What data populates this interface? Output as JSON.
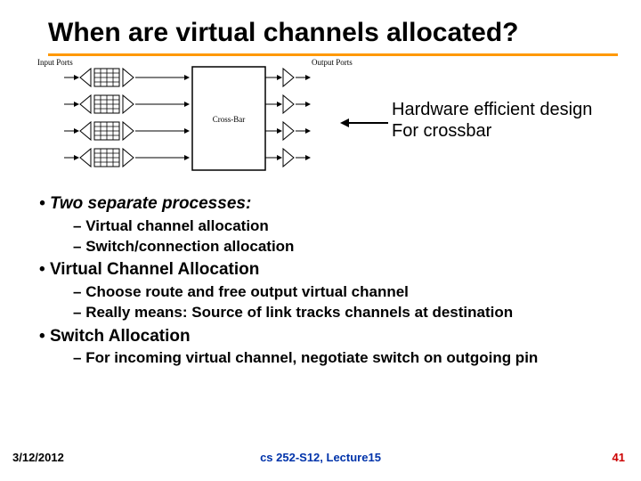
{
  "title": "When are virtual channels allocated?",
  "diagram": {
    "input_label": "Input Ports",
    "output_label": "Output Ports",
    "crossbar_label": "Cross-Bar"
  },
  "annotation": {
    "line1": "Hardware efficient design",
    "line2": "For crossbar"
  },
  "bullets": {
    "b1": "Two separate processes:",
    "b1a": "Virtual channel allocation",
    "b1b": "Switch/connection allocation",
    "b2": "Virtual Channel Allocation",
    "b2a": "Choose route and free output virtual channel",
    "b2b": "Really means: Source of link tracks channels at destination",
    "b3": "Switch Allocation",
    "b3a": "For incoming virtual channel, negotiate switch on outgoing pin"
  },
  "footer": {
    "left": "3/12/2012",
    "center": "cs 252-S12, Lecture15",
    "right": "41"
  }
}
